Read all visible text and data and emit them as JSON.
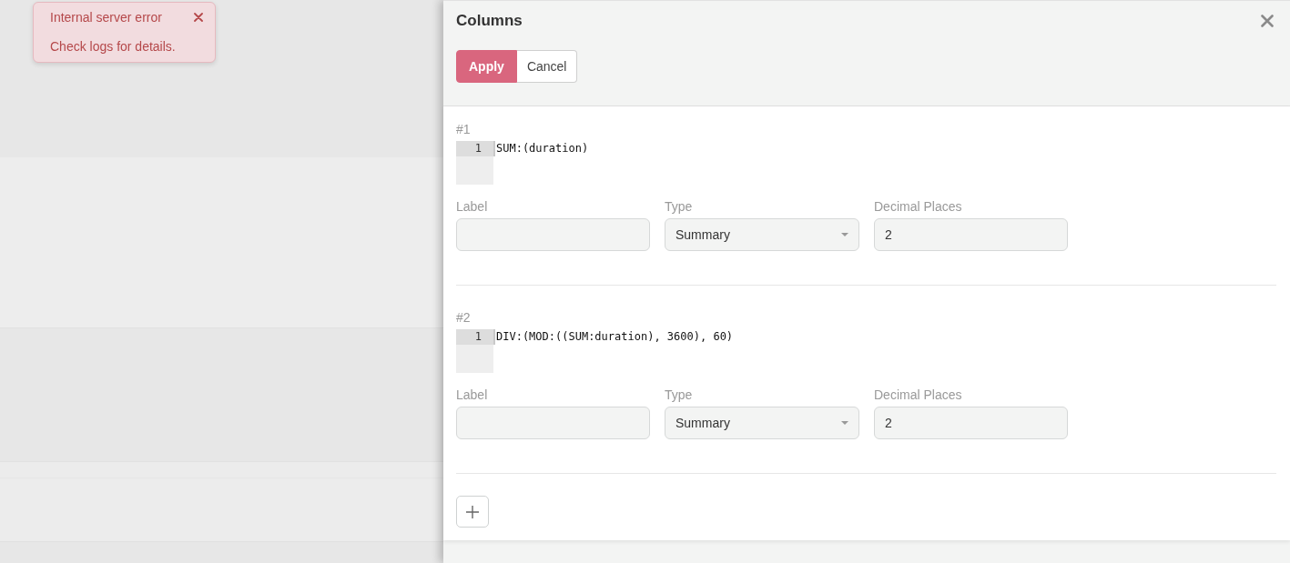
{
  "toast": {
    "title": "Internal server error",
    "message": "Check logs for details."
  },
  "drawer": {
    "title": "Columns",
    "buttons": [
      {
        "label": "Apply",
        "kind": "primary"
      },
      {
        "label": "Cancel",
        "kind": "secondary"
      }
    ]
  },
  "columns": [
    {
      "heading": "#1",
      "editor": {
        "lines": [
          {
            "number": "1",
            "code": "SUM:(duration)"
          }
        ]
      },
      "fields": [
        {
          "label": "Label",
          "kind": "text"
        },
        {
          "label": "Type",
          "kind": "select",
          "value": "Summary"
        },
        {
          "label": "Decimal Places",
          "kind": "text",
          "value": "2"
        }
      ]
    },
    {
      "heading": "#2",
      "editor": {
        "lines": [
          {
            "number": "1",
            "code": "DIV:(MOD:((SUM:duration), 3600), 60)"
          }
        ]
      },
      "fields": [
        {
          "label": "Label",
          "kind": "text"
        },
        {
          "label": "Type",
          "kind": "select",
          "value": "Summary"
        },
        {
          "label": "Decimal Places",
          "kind": "text",
          "value": "2"
        }
      ]
    }
  ]
}
